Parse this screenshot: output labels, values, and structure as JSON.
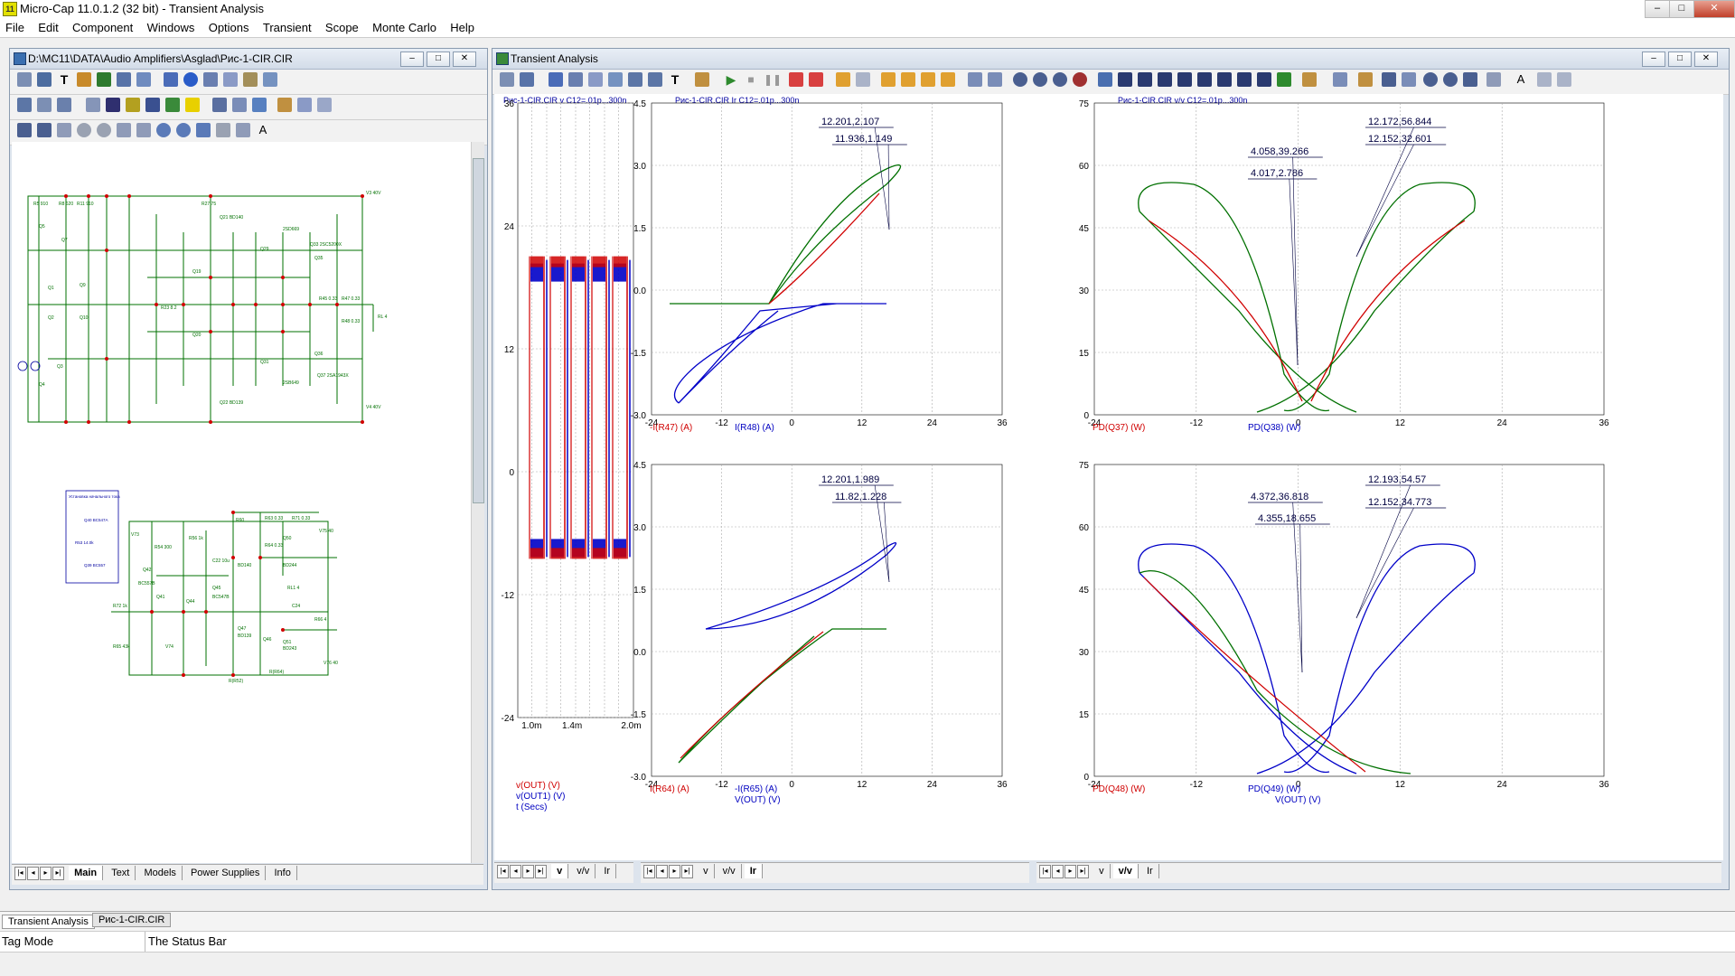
{
  "app": {
    "title": "Micro-Cap 11.0.1.2 (32 bit) - Transient Analysis",
    "icon_label": "11",
    "window_buttons": [
      "–",
      "□",
      "✕"
    ]
  },
  "menu": [
    "File",
    "Edit",
    "Component",
    "Windows",
    "Options",
    "Transient",
    "Scope",
    "Monte Carlo",
    "Help"
  ],
  "schematic_window": {
    "title": "D:\\MC11\\DATA\\Audio Amplifiers\\Asglad\\Рис-1-CIR.CIR",
    "tabs": [
      "Main",
      "Text",
      "Models",
      "Power Supplies",
      "Info"
    ],
    "active_tab": "Main",
    "components": {
      "supplies": [
        "V3 40V",
        "V4 40V",
        "V75 40",
        "V76 40"
      ],
      "labels": [
        "R5 910",
        "R8 620",
        "R11 910",
        "R27 75",
        "Q21 BD140",
        "Q22 BD139",
        "Q33 2SC5200X",
        "Q37 2SA1943X",
        "Q35",
        "Q36",
        "RL 4",
        "R23 8.2",
        "R45 0.33",
        "R47 0.33",
        "R48 0.33",
        "2SB649",
        "2SD669",
        "Q1",
        "Q2",
        "Q3",
        "Q4",
        "Q5",
        "Q7",
        "Q9",
        "Q10",
        "Q19",
        "Q20",
        "Q29",
        "Q31"
      ],
      "box_title": "Установка начального тока",
      "box_labels": [
        "Q40 BC547A",
        "R53 14.0k",
        "Q39 BC557"
      ],
      "lower_labels": [
        "V73",
        "R54 300",
        "R56 1k",
        "R60",
        "R63 0.33",
        "R64 0.33",
        "R71 0.33",
        "R72 1k",
        "R65 43k",
        "V74",
        "Q41",
        "Q42",
        "Q44",
        "Q45",
        "Q46",
        "Q47",
        "Q50",
        "Q51",
        "BC557B",
        "BC547B",
        "BD139",
        "BD140",
        "BD243",
        "BD244",
        "C22 10u",
        "C24",
        "R66 4",
        "RL1 4",
        "R(R52)",
        "R(R64)"
      ]
    }
  },
  "analysis_window": {
    "title": "Transient Analysis",
    "tabs": [
      "v",
      "v/v",
      "Ir"
    ],
    "active_tab": "Ir"
  },
  "plot1": {
    "title": "Рис-1-CIR.CIR v C12=.01p...300n",
    "yticks": [
      "36",
      "24",
      "12",
      "0",
      "-12",
      "-24"
    ],
    "xticks": [
      "1.0m",
      "1.4m",
      "2.0m"
    ],
    "legend": [
      {
        "text": "v(OUT) (V)",
        "color": "#d00000"
      },
      {
        "text": "v(OUT1) (V)",
        "color": "#0000c0"
      },
      {
        "text": "t (Secs)",
        "color": "#0000c0"
      }
    ]
  },
  "plot2": {
    "title": "Рис-1-CIR.CIR Ir C12=.01p...300n",
    "top_yticks": [
      "4.5",
      "3.0",
      "1.5",
      "0.0",
      "-1.5",
      "-3.0"
    ],
    "bottom_yticks": [
      "4.5",
      "3.0",
      "1.5",
      "0.0",
      "-1.5",
      "-3.0"
    ],
    "xticks": [
      "-24",
      "-12",
      "0",
      "12",
      "24",
      "36"
    ],
    "top_labels": [
      {
        "text": "-I(R47) (A)",
        "color": "#d00000"
      },
      {
        "text": "I(R48) (A)",
        "color": "#0000c0"
      }
    ],
    "bottom_labels": [
      {
        "text": "I(R64) (A)",
        "color": "#d00000"
      },
      {
        "text": "-I(R65) (A)",
        "color": "#0000c0"
      },
      {
        "text": "V(OUT) (V)",
        "color": "#0000c0"
      }
    ],
    "top_cursors": [
      "12.201,2.107",
      "11.936,1.149"
    ],
    "bottom_cursors": [
      "12.201,1.989",
      "11.82,1.228"
    ]
  },
  "plot3": {
    "title": "Рис-1-CIR.CIR v/v C12=.01p...300n",
    "yticks": [
      "75",
      "60",
      "45",
      "30",
      "15",
      "0"
    ],
    "xticks": [
      "-24",
      "-12",
      "0",
      "12",
      "24",
      "36"
    ],
    "top_labels": [
      {
        "text": "PD(Q37) (W)",
        "color": "#d00000"
      },
      {
        "text": "PD(Q38) (W)",
        "color": "#0000c0"
      }
    ],
    "bottom_labels": [
      {
        "text": "PD(Q48) (W)",
        "color": "#d00000"
      },
      {
        "text": "PD(Q49) (W)",
        "color": "#0000c0"
      },
      {
        "text": "V(OUT) (V)",
        "color": "#0000c0"
      }
    ],
    "top_cursors": [
      "12.172,56.844",
      "12.152,32.601",
      "4.058,39.266",
      "4.017,2.786"
    ],
    "bottom_cursors": [
      "12.193,54.57",
      "12.152,34.773",
      "4.372,36.818",
      "4.355,18.655"
    ]
  },
  "bottom_tabs": [
    "Transient Analysis",
    "Рис-1-CIR.CIR"
  ],
  "status": {
    "mode": "Tag Mode",
    "message": "The Status Bar"
  },
  "colors": {
    "red": "#d00000",
    "blue": "#0000c8",
    "green": "#007000",
    "schematic_wire": "#007000",
    "grid": "#aaaaaa"
  }
}
